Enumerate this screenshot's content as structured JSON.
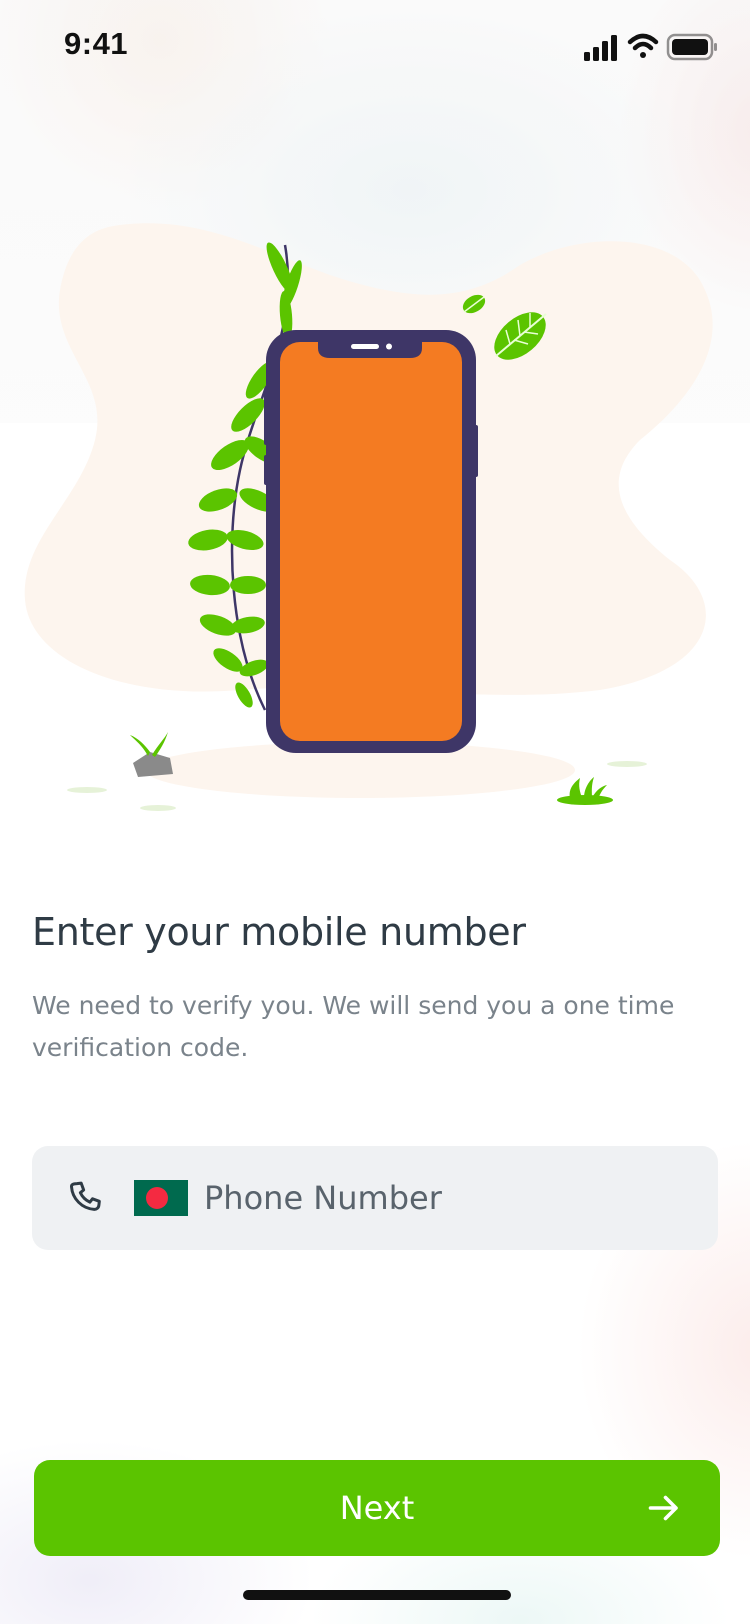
{
  "status_bar": {
    "time": "9:41",
    "icons": [
      "signal-icon",
      "wifi-icon",
      "battery-icon"
    ]
  },
  "illustration": {
    "name": "phone-with-plant-illustration",
    "colors": {
      "phone_frame": "#3e3667",
      "phone_screen": "#f47b22",
      "leaf": "#5bc400",
      "blob": "#fdf5ee"
    }
  },
  "content": {
    "title": "Enter your mobile number",
    "subtitle": "We need to verify you. We will send you a one time verification code."
  },
  "phone_field": {
    "icon": "phone-icon",
    "flag": "bangladesh-flag",
    "placeholder": "Phone Number",
    "value": ""
  },
  "next_button": {
    "label": "Next",
    "icon": "arrow-right-icon",
    "color": "#5bc400"
  }
}
